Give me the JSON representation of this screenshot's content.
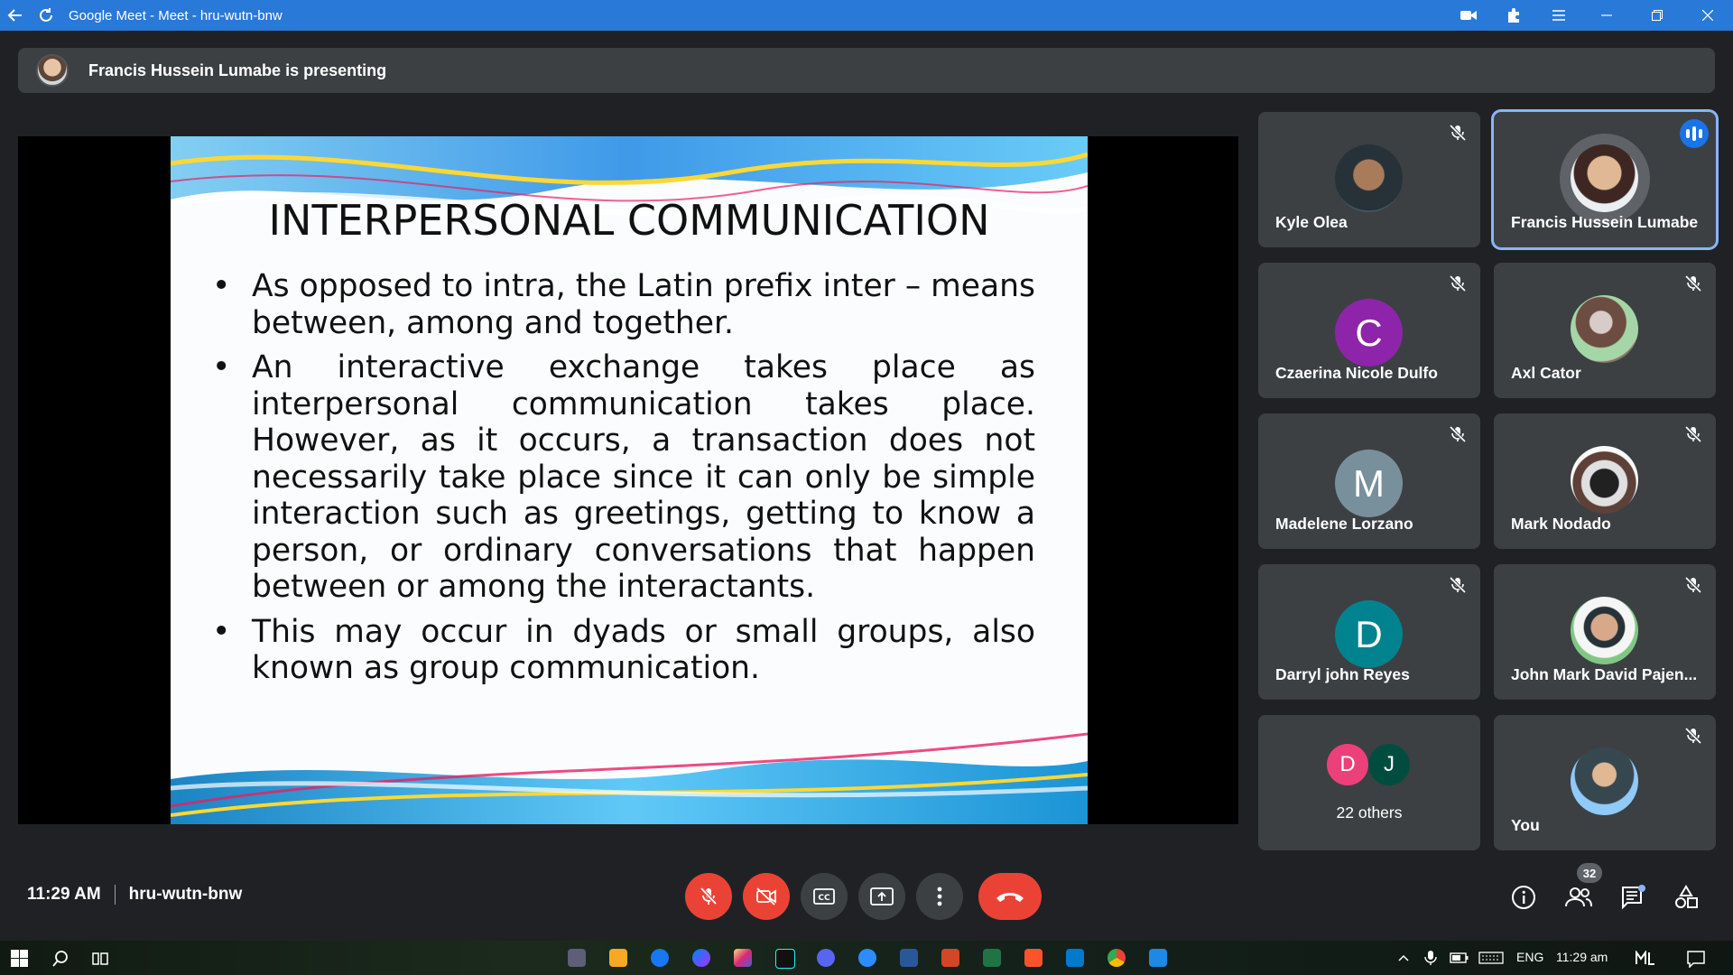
{
  "window": {
    "title": "Google Meet - Meet - hru-wutn-bnw",
    "accent": "#2979d9"
  },
  "banner": {
    "text": "Francis Hussein Lumabe is presenting"
  },
  "slide": {
    "title": "INTERPERSONAL COMMUNICATION",
    "bullets": [
      "As opposed to intra, the Latin prefix inter – means between, among and together.",
      "An interactive exchange takes place as interpersonal communication takes place. However, as it occurs, a transaction does not necessarily take place since it can only be simple interaction such as greetings, getting to know a person, or ordinary conversations that happen between or among the interactants.",
      "This may occur in dyads or small groups, also known as group communication."
    ]
  },
  "participants": [
    {
      "name": "Kyle Olea",
      "muted": true,
      "avatar": "photo"
    },
    {
      "name": "Francis Hussein Lumabe",
      "speaking": true,
      "avatar": "photo"
    },
    {
      "name": "Czaerina Nicole Dulfo",
      "muted": true,
      "initial": "C",
      "color": "#8e24aa"
    },
    {
      "name": "Axl Cator",
      "muted": true,
      "avatar": "photo"
    },
    {
      "name": "Madelene Lorzano",
      "muted": true,
      "initial": "M",
      "color": "#78909c"
    },
    {
      "name": "Mark Nodado",
      "muted": true,
      "avatar": "photo"
    },
    {
      "name": "Darryl john Reyes",
      "muted": true,
      "initial": "D",
      "color": "#00838f"
    },
    {
      "name": "John Mark David Pajen...",
      "muted": true,
      "avatar": "photo"
    },
    {
      "others_label": "22 others",
      "initials": [
        "D",
        "J"
      ],
      "colors": [
        "#ec407a",
        "#004d40"
      ]
    },
    {
      "name": "You",
      "muted": true,
      "avatar": "photo"
    }
  ],
  "bottom": {
    "time": "11:29 AM",
    "code": "hru-wutn-bnw",
    "people_count": "32",
    "controls": [
      "mic-off",
      "camera-off",
      "captions",
      "present",
      "more",
      "leave-call"
    ]
  },
  "taskbar": {
    "lang": "ENG",
    "time": "11:29 am"
  }
}
